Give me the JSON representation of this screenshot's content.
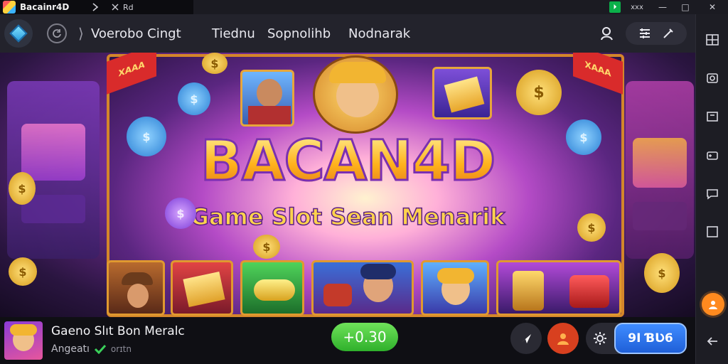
{
  "window": {
    "app_title": "Bacainr4D",
    "subtitle": "Rd",
    "controls": [
      "—",
      "□",
      "✕"
    ],
    "extra_label": "xxx"
  },
  "nav": {
    "crumb_separator": "⟩",
    "items": [
      {
        "label": "Voerobo Cingt"
      },
      {
        "label": "Tiednu"
      },
      {
        "label": "Sopnolihb"
      },
      {
        "label": "Nodnarak"
      }
    ]
  },
  "game": {
    "title": "BACAN4D",
    "tagline": "Game Slot Sean Menarik",
    "ribbons": [
      "XAAA",
      "XAAA"
    ],
    "coin_symbol": "$"
  },
  "bottom": {
    "game_name": "Gaeno Slıt Bon Meralc",
    "game_sub": "Angeatı",
    "game_sub_extra": "orɪtn",
    "score": "+0.30",
    "action_label": "9I ƁƲ6"
  },
  "colors": {
    "accent_orange": "#ff8a1f",
    "score_green": "#2fb02b",
    "action_blue": "#1f5fd8",
    "frame_gold": "#d4862a"
  },
  "icons": {
    "sidebar": [
      "layout-icon",
      "screenshot-icon",
      "camera-icon",
      "gamepad-icon",
      "message-icon",
      "square-icon",
      "user-icon",
      "back-arrow-icon"
    ]
  }
}
